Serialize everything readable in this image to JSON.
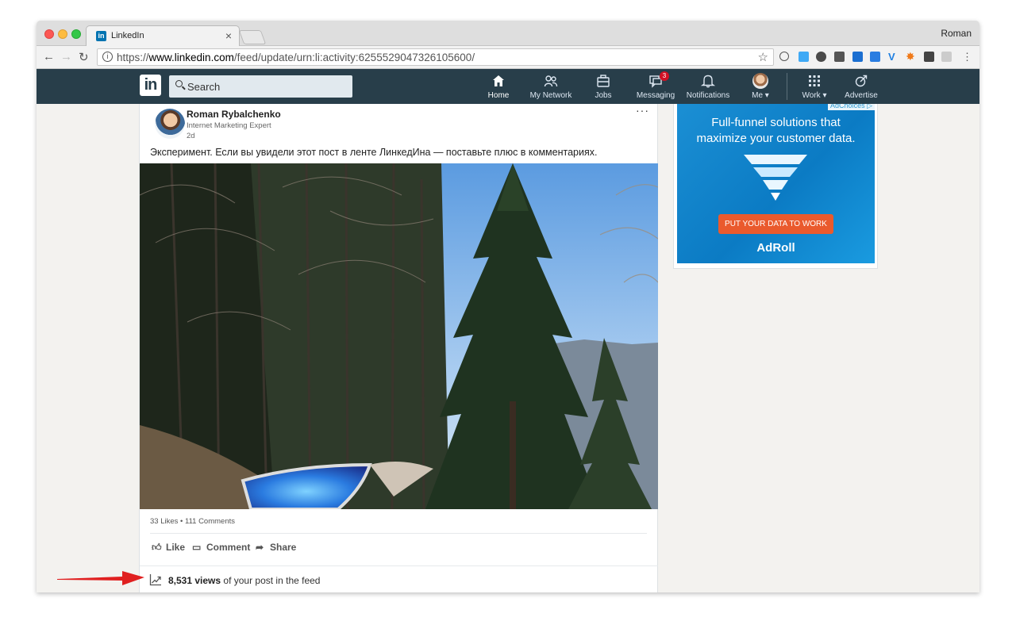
{
  "browser": {
    "tab_title": "LinkedIn",
    "tab_close": "×",
    "profile_name": "Roman",
    "url_prefix": "https://",
    "url_host": "www.linkedin.com",
    "url_path": "/feed/update/urn:li:activity:6255529047326105600/"
  },
  "linkedin_nav": {
    "logo": "in",
    "search_placeholder": "Search",
    "items": [
      {
        "label": "Home",
        "icon": "home-icon"
      },
      {
        "label": "My Network",
        "icon": "network-icon"
      },
      {
        "label": "Jobs",
        "icon": "briefcase-icon"
      },
      {
        "label": "Messaging",
        "icon": "messaging-icon",
        "badge": "3"
      },
      {
        "label": "Notifications",
        "icon": "bell-icon"
      },
      {
        "label": "Me ▾",
        "icon": "avatar"
      },
      {
        "label": "Work ▾",
        "icon": "grid-icon"
      },
      {
        "label": "Advertise",
        "icon": "advertise-icon"
      }
    ]
  },
  "post": {
    "author_name": "Roman Rybalchenko",
    "author_title": "Internet Marketing Expert",
    "time": "2d",
    "more": "···",
    "text": "Эксперимент. Если вы увидели этот пост в ленте ЛинкедИна — поставьте плюс в комментариях.",
    "social_counts": "33 Likes • 111 Comments",
    "actions": {
      "like": "Like",
      "comment": "Comment",
      "share": "Share"
    },
    "views_count": "8,531 views",
    "views_suffix": " of your post in the feed"
  },
  "ad": {
    "adchoices": "AdChoices ▷",
    "headline_line1": "Full-funnel solutions that",
    "headline_line2": "maximize your customer data.",
    "cta": "PUT YOUR DATA TO WORK",
    "brand": "AdRoll"
  },
  "colors": {
    "linkedin_nav_bg": "#283e4a",
    "linkedin_blue": "#0073b1",
    "ad_cta": "#ea5a2d",
    "annotation_arrow": "#e02020"
  }
}
